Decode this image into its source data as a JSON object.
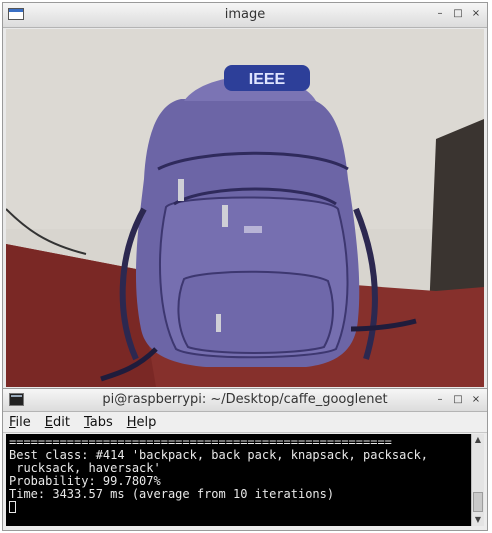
{
  "image_window": {
    "title": "image",
    "controls": {
      "minimize": "–",
      "maximize": "□",
      "close": "×"
    },
    "photo": {
      "badge_text": "IEEE",
      "colors": {
        "bag": "#6e66a8",
        "wall": "#d9d6d0",
        "floor": "#8a2a2a"
      }
    }
  },
  "terminal_window": {
    "title": "pi@raspberrypi: ~/Desktop/caffe_googlenet",
    "controls": {
      "minimize": "–",
      "maximize": "□",
      "close": "×"
    },
    "menu": [
      {
        "label": "File",
        "mnemonic": "F",
        "rest": "ile"
      },
      {
        "label": "Edit",
        "mnemonic": "E",
        "rest": "dit"
      },
      {
        "label": "Tabs",
        "mnemonic": "T",
        "rest": "abs"
      },
      {
        "label": "Help",
        "mnemonic": "H",
        "rest": "elp"
      }
    ],
    "output": {
      "separator": "=====================================================",
      "line1": "Best class: #414 'backpack, back pack, knapsack, packsack,",
      "line2": " rucksack, haversack'",
      "line3": "Probability: 99.7807%",
      "line4": "Time: 3433.57 ms (average from 10 iterations)"
    }
  }
}
